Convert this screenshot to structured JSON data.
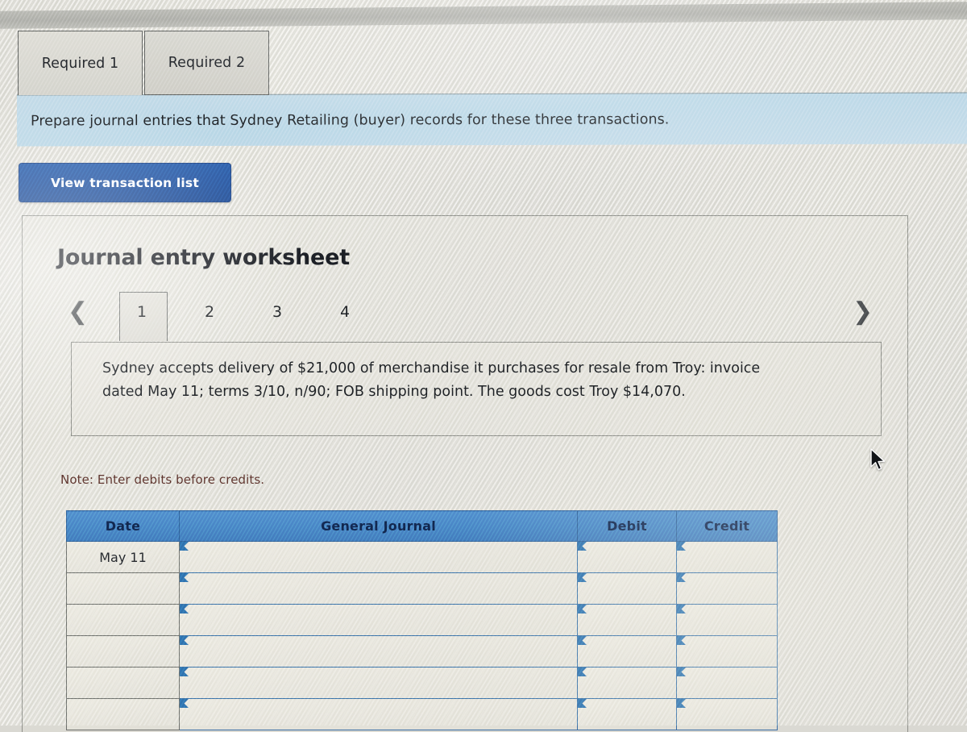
{
  "requirement_tabs": [
    {
      "label": "Required 1",
      "active": true
    },
    {
      "label": "Required 2",
      "active": false
    }
  ],
  "instruction": {
    "text": "Prepare journal entries that Sydney Retailing (buyer) records for these three transactions."
  },
  "toolbar": {
    "view_transaction_list_label": "View transaction list"
  },
  "worksheet": {
    "title": "Journal entry worksheet",
    "pager": {
      "prev_icon": "chevron-left-icon",
      "next_icon": "chevron-right-icon",
      "pages": [
        "1",
        "2",
        "3",
        "4"
      ],
      "active_page": "1"
    },
    "transaction_description": "Sydney accepts delivery of $21,000 of merchandise it purchases for resale from Troy: invoice dated May 11; terms 3/10, n/90; FOB shipping point. The goods cost Troy $14,070.",
    "note": "Note: Enter debits before credits.",
    "table": {
      "headers": [
        "Date",
        "General Journal",
        "Debit",
        "Credit"
      ],
      "rows": [
        {
          "date": "May 11",
          "general_journal": "",
          "debit": "",
          "credit": ""
        },
        {
          "date": "",
          "general_journal": "",
          "debit": "",
          "credit": ""
        },
        {
          "date": "",
          "general_journal": "",
          "debit": "",
          "credit": ""
        },
        {
          "date": "",
          "general_journal": "",
          "debit": "",
          "credit": ""
        },
        {
          "date": "",
          "general_journal": "",
          "debit": "",
          "credit": ""
        },
        {
          "date": "",
          "general_journal": "",
          "debit": "",
          "credit": ""
        }
      ]
    }
  },
  "colors": {
    "header_blue": "#4682c4",
    "instruction_bar_blue": "#bdd8e7",
    "button_blue": "#24529d",
    "note_red": "#5a322c",
    "cell_border_blue": "#3a6ea5"
  },
  "cursor": {
    "icon": "mouse-pointer-icon"
  }
}
